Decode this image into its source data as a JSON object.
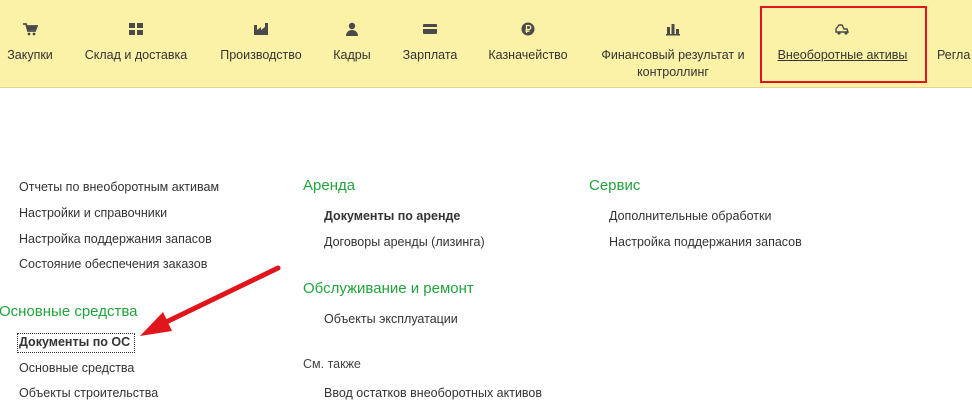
{
  "top_nav": [
    {
      "label": "Закупки",
      "icon": "cart-icon"
    },
    {
      "label": "Склад и доставка",
      "icon": "warehouse-icon"
    },
    {
      "label": "Производство",
      "icon": "factory-icon"
    },
    {
      "label": "Кадры",
      "icon": "person-icon"
    },
    {
      "label": "Зарплата",
      "icon": "wallet-icon"
    },
    {
      "label": "Казначейство",
      "icon": "ruble-coin-icon"
    },
    {
      "label": "Финансовый результат и",
      "label2": "контроллинг",
      "icon": "bar-chart-icon"
    },
    {
      "label": "Внеоборотные активы",
      "icon": "truck-icon",
      "active": true
    },
    {
      "label": "Регла"
    }
  ],
  "left_column": {
    "links": [
      "Отчеты по внеоборотным активам",
      "Настройки и справочники",
      "Настройка поддержания запасов",
      "Состояние обеспечения заказов"
    ],
    "fixed_assets": {
      "title": "Основные средства",
      "links": [
        "Документы по ОС",
        "Основные средства",
        "Объекты строительства"
      ]
    }
  },
  "middle_column": {
    "rent": {
      "title": "Аренда",
      "links": [
        "Документы по аренде",
        "Договоры аренды (лизинга)"
      ]
    },
    "maintenance": {
      "title": "Обслуживание и ремонт",
      "links": [
        "Объекты эксплуатации"
      ]
    },
    "see_also": {
      "title": "См. также",
      "links": [
        "Ввод остатков внеоборотных активов"
      ]
    }
  },
  "right_column": {
    "service": {
      "title": "Сервис",
      "links": [
        "Дополнительные обработки",
        "Настройка поддержания запасов"
      ]
    }
  },
  "colors": {
    "topbar": "#fcf2a7",
    "section_green": "#23a33d",
    "highlight_red": "#e0161b"
  }
}
